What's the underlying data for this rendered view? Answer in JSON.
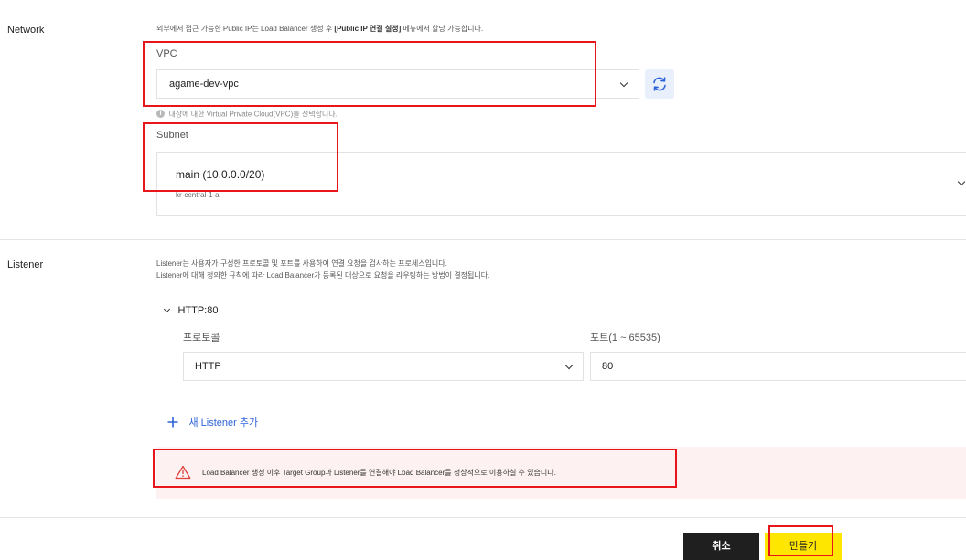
{
  "network": {
    "section_label": "Network",
    "description_pre": "외부에서 접근 가능한 Public IP는 Load Balancer 생성 후 ",
    "description_bold": "[Public IP 연결 설정]",
    "description_post": " 메뉴에서 할당 가능합니다.",
    "vpc": {
      "label": "VPC",
      "selected": "agame-dev-vpc",
      "hint": "대상에 대한 Virtual Private Cloud(VPC)를 선택합니다."
    },
    "subnet": {
      "label": "Subnet",
      "selected_name": "main (10.0.0.0/20)",
      "selected_zone": "kr-central-1-a"
    }
  },
  "listener": {
    "section_label": "Listener",
    "description_line1": "Listener는 사용자가 구성한 프로토콜 및 포트를 사용하여 연결 요청을 검사하는 프로세스입니다.",
    "description_line2": "Listener에 대해 정의한 규칙에 따라 Load Balancer가 등록된 대상으로 요청을 라우팅하는 방법이 결정됩니다.",
    "item_title": "HTTP:80",
    "protocol_label": "프로토콜",
    "protocol_value": "HTTP",
    "port_label": "포트(1 ~ 65535)",
    "port_value": "80",
    "add_label": "새 Listener 추가"
  },
  "warning": {
    "text": "Load Balancer 생성 이후 Target Group과 Listener를 연결해야 Load Balancer를 정상적으로 이용하실 수 있습니다."
  },
  "footer": {
    "cancel_label": "취소",
    "create_label": "만들기"
  },
  "colors": {
    "accent": "#2d63d8",
    "annotation_red": "#e8161b",
    "highlight_yellow": "#ffe600",
    "warning_bg": "#fdf1f1",
    "cancel_bg": "#1f1f1f"
  }
}
